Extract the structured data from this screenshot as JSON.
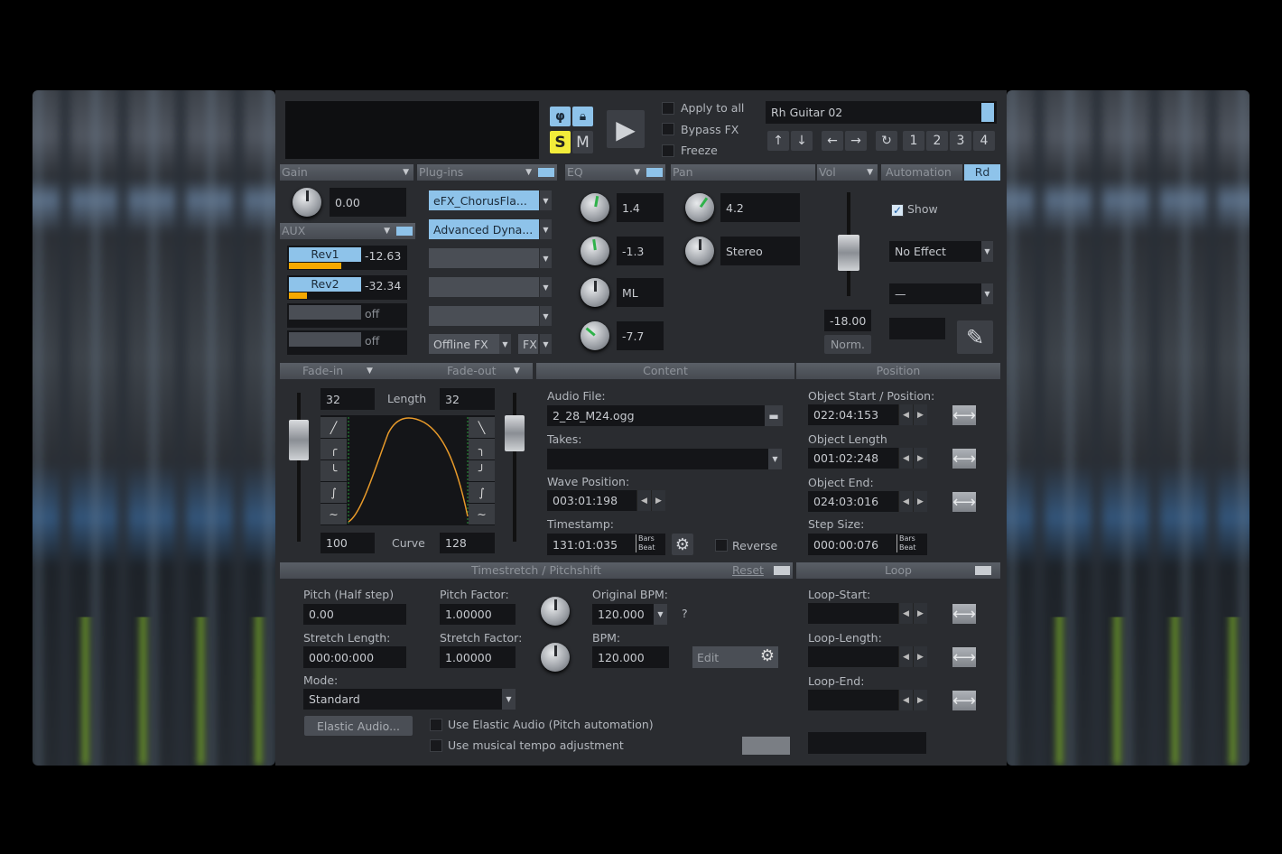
{
  "display": {
    "track_name": "Rh Guitar 02"
  },
  "transport": {
    "phase_icon": "φ",
    "lock_icon": "lock-icon",
    "solo": "S",
    "mute": "M",
    "play_icon": "play-icon"
  },
  "options": [
    {
      "label": "Apply to all",
      "checked": false
    },
    {
      "label": "Bypass FX",
      "checked": false
    },
    {
      "label": "Freeze",
      "checked": false
    }
  ],
  "nav_buttons": [
    "↑",
    "↓",
    "←",
    "→",
    "↻",
    "1",
    "2",
    "3",
    "4"
  ],
  "headers": {
    "gain": "Gain",
    "plugins": "Plug-ins",
    "eq": "EQ",
    "pan": "Pan",
    "vol": "Vol",
    "automation": "Automation",
    "rd": "Rd",
    "aux": "AUX",
    "fade_in": "Fade-in",
    "fade_out": "Fade-out",
    "content": "Content",
    "position": "Position",
    "timestretch": "Timestretch / Pitchshift",
    "reset": "Reset",
    "loop": "Loop"
  },
  "gain": {
    "value": "0.00"
  },
  "aux": [
    {
      "label": "Rev1",
      "value": "-12.63",
      "level": 0.72
    },
    {
      "label": "Rev2",
      "value": "-32.34",
      "level": 0.25
    },
    {
      "label": "",
      "value": "off",
      "level": 0
    },
    {
      "label": "",
      "value": "off",
      "level": 0
    }
  ],
  "plugins": {
    "slots": [
      "eFX_ChorusFla...",
      "Advanced Dyna...",
      "",
      "",
      ""
    ],
    "offline_fx": "Offline FX",
    "fx": "FX"
  },
  "eq": {
    "values": [
      "1.4",
      "-1.3",
      "ML",
      "-7.7"
    ]
  },
  "pan": {
    "values": [
      "4.2",
      "Stereo"
    ]
  },
  "vol": {
    "value": "-18.00",
    "norm": "Norm."
  },
  "automation": {
    "show_label": "Show",
    "show_checked": true,
    "effect": "No Effect",
    "param": "—"
  },
  "fade": {
    "in_length": "32",
    "length_label": "Length",
    "out_length": "32",
    "in_curve": "100",
    "curve_label": "Curve",
    "out_curve": "128"
  },
  "content": {
    "audio_file_label": "Audio File:",
    "audio_file": "2_28_M24.ogg",
    "takes_label": "Takes:",
    "takes": "",
    "wave_position_label": "Wave Position:",
    "wave_position": "003:01:198",
    "timestamp_label": "Timestamp:",
    "timestamp": "131:01:035",
    "unit_bars": "Bars",
    "unit_beat": "Beat",
    "reverse_label": "Reverse"
  },
  "position": {
    "start_label": "Object Start / Position:",
    "start": "022:04:153",
    "length_label": "Object Length",
    "length": "001:02:248",
    "end_label": "Object End:",
    "end": "024:03:016",
    "step_label": "Step Size:",
    "step": "000:00:076"
  },
  "timestretch": {
    "pitch_label": "Pitch (Half step)",
    "pitch": "0.00",
    "pitch_factor_label": "Pitch Factor:",
    "pitch_factor": "1.00000",
    "orig_bpm_label": "Original BPM:",
    "orig_bpm": "120.000",
    "help": "?",
    "stretch_length_label": "Stretch Length:",
    "stretch_length": "000:00:000",
    "stretch_factor_label": "Stretch Factor:",
    "stretch_factor": "1.00000",
    "bpm_label": "BPM:",
    "bpm": "120.000",
    "edit": "Edit",
    "mode_label": "Mode:",
    "mode": "Standard",
    "elastic_button": "Elastic Audio...",
    "use_elastic": "Use Elastic Audio (Pitch automation)",
    "use_musical": "Use musical tempo adjustment"
  },
  "loop": {
    "start_label": "Loop-Start:",
    "length_label": "Loop-Length:",
    "end_label": "Loop-End:"
  },
  "colors": {
    "accent_blue": "#8ec3ea",
    "solo_yellow": "#f2ec3a",
    "aux_orange": "#f5a800",
    "fade_curve": "#e89a2a"
  }
}
